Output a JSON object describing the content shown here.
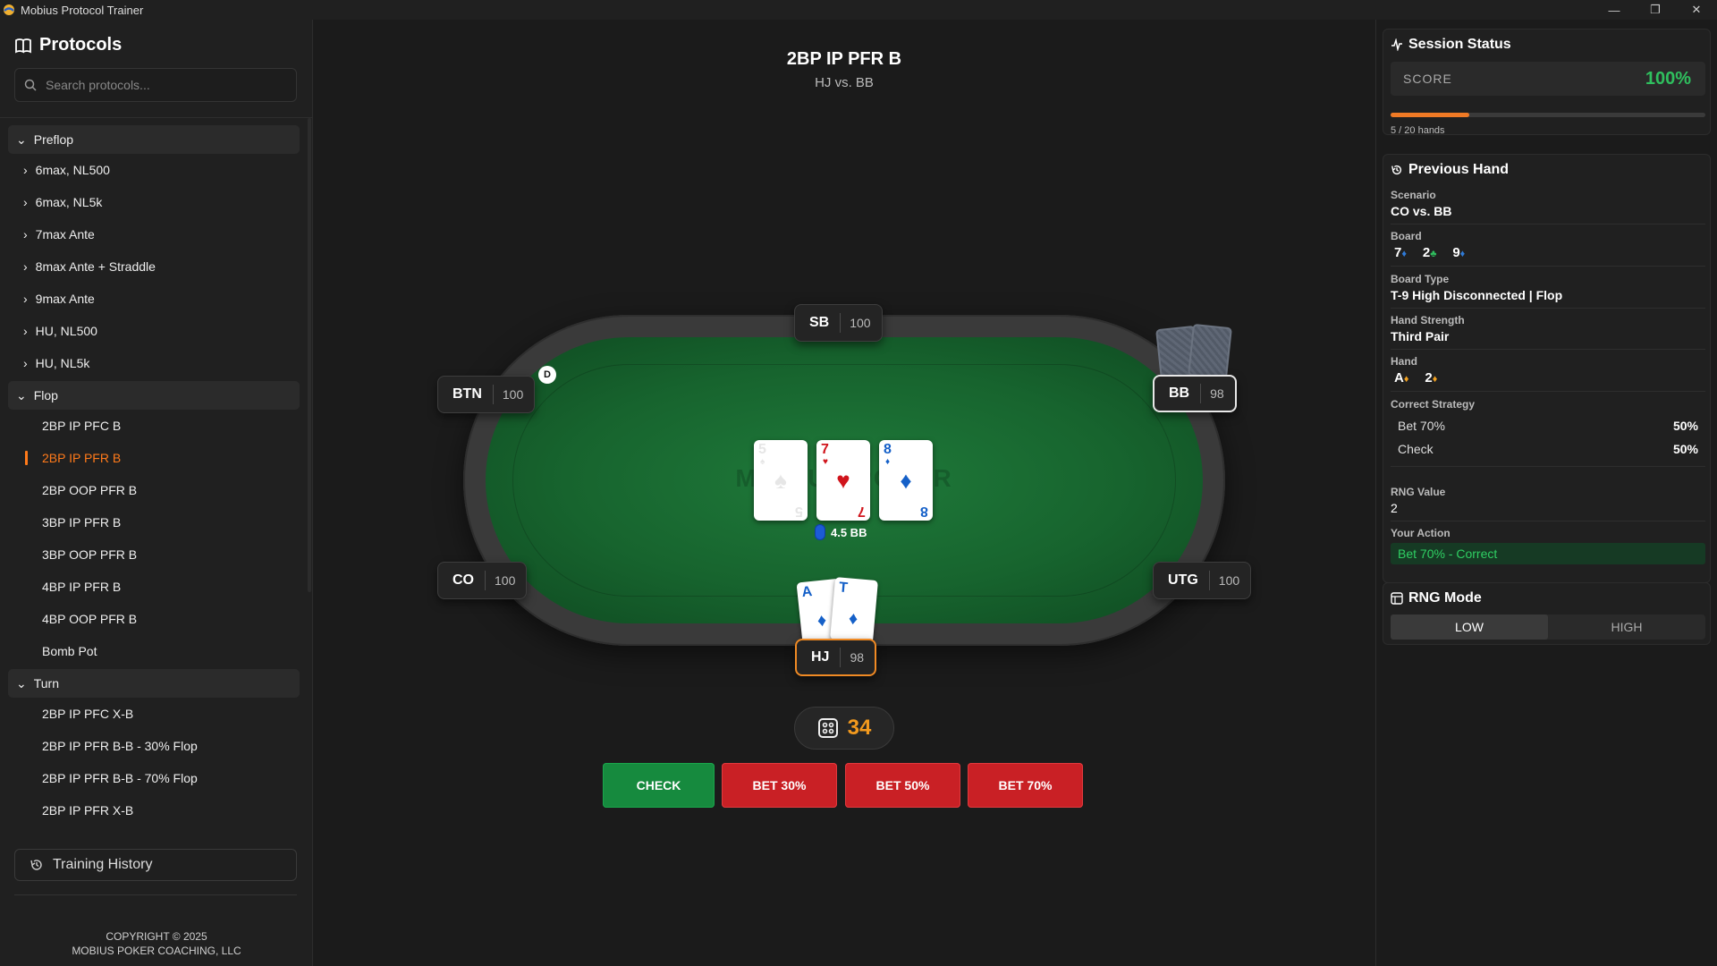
{
  "window": {
    "title": "Mobius Protocol Trainer",
    "controls": [
      "—",
      "❐",
      "✕"
    ]
  },
  "sidebar": {
    "title": "Protocols",
    "search_placeholder": "Search protocols...",
    "sections": [
      {
        "label": "Preflop",
        "items": [
          {
            "label": "6max, NL500",
            "type": "folder"
          },
          {
            "label": "6max, NL5k",
            "type": "folder"
          },
          {
            "label": "7max Ante",
            "type": "folder"
          },
          {
            "label": "8max Ante + Straddle",
            "type": "folder"
          },
          {
            "label": "9max Ante",
            "type": "folder"
          },
          {
            "label": "HU, NL500",
            "type": "folder"
          },
          {
            "label": "HU, NL5k",
            "type": "folder"
          }
        ]
      },
      {
        "label": "Flop",
        "items": [
          {
            "label": "2BP IP PFC B",
            "type": "leaf"
          },
          {
            "label": "2BP IP PFR B",
            "type": "leaf",
            "active": true
          },
          {
            "label": "2BP OOP PFR B",
            "type": "leaf"
          },
          {
            "label": "3BP IP PFR B",
            "type": "leaf"
          },
          {
            "label": "3BP OOP PFR B",
            "type": "leaf"
          },
          {
            "label": "4BP IP PFR B",
            "type": "leaf"
          },
          {
            "label": "4BP OOP PFR B",
            "type": "leaf"
          },
          {
            "label": "Bomb Pot",
            "type": "leaf"
          }
        ]
      },
      {
        "label": "Turn",
        "items": [
          {
            "label": "2BP IP PFC X-B",
            "type": "leaf"
          },
          {
            "label": "2BP IP PFR B-B - 30% Flop",
            "type": "leaf"
          },
          {
            "label": "2BP IP PFR B-B - 70% Flop",
            "type": "leaf"
          },
          {
            "label": "2BP IP PFR X-B",
            "type": "leaf"
          }
        ]
      }
    ],
    "history_label": "Training History",
    "copyright_line1": "COPYRIGHT © 2025",
    "copyright_line2": "MOBIUS POKER COACHING, LLC"
  },
  "main": {
    "scenario_title": "2BP IP PFR B",
    "scenario_sub": "HJ vs. BB",
    "watermark": "MOBIUS POKER",
    "dealer_label": "D",
    "seats": {
      "sb": {
        "pos": "SB",
        "stack": "100"
      },
      "btn": {
        "pos": "BTN",
        "stack": "100"
      },
      "bb": {
        "pos": "BB",
        "stack": "98"
      },
      "co": {
        "pos": "CO",
        "stack": "100"
      },
      "utg": {
        "pos": "UTG",
        "stack": "100"
      },
      "hj": {
        "pos": "HJ",
        "stack": "98"
      }
    },
    "board": [
      {
        "rank": "5",
        "suit": "♠",
        "color": "#111111"
      },
      {
        "rank": "7",
        "suit": "♥",
        "color": "#d0141b"
      },
      {
        "rank": "8",
        "suit": "♦",
        "color": "#1560c8"
      }
    ],
    "pot": "4.5 BB",
    "hero_cards": [
      {
        "rank": "A",
        "suit": "♦"
      },
      {
        "rank": "T",
        "suit": "♦"
      }
    ],
    "timer": "34",
    "actions": [
      "CHECK",
      "BET 30%",
      "BET 50%",
      "BET 70%"
    ]
  },
  "session": {
    "title": "Session Status",
    "score_label": "SCORE",
    "score_value": "100%",
    "progress_fraction": 0.25,
    "hands": "5 / 20 hands",
    "accent": "#f07a25"
  },
  "previous_hand": {
    "title": "Previous Hand",
    "scenario_label": "Scenario",
    "scenario": "CO vs. BB",
    "board_label": "Board",
    "board": [
      {
        "rank": "7",
        "suit": "♦",
        "color": "#2f7ad6"
      },
      {
        "rank": "2",
        "suit": "♣",
        "color": "#2fbf5e"
      },
      {
        "rank": "9",
        "suit": "♦",
        "color": "#2f7ad6"
      }
    ],
    "board_type_label": "Board Type",
    "board_type": "T-9 High Disconnected | Flop",
    "strength_label": "Hand Strength",
    "strength": "Third Pair",
    "hand_label": "Hand",
    "hand": [
      {
        "rank": "A",
        "suit": "♦",
        "color": "#f0a020"
      },
      {
        "rank": "2",
        "suit": "♦",
        "color": "#f0a020"
      }
    ],
    "strategy_label": "Correct Strategy",
    "strategy": [
      {
        "action": "Bet 70%",
        "freq": "50%"
      },
      {
        "action": "Check",
        "freq": "50%"
      }
    ],
    "rng_label": "RNG Value",
    "rng": "2",
    "your_action_label": "Your Action",
    "your_action": "Bet 70% - Correct"
  },
  "rng_mode": {
    "title": "RNG Mode",
    "options": [
      "LOW",
      "HIGH"
    ],
    "selected": "LOW"
  }
}
